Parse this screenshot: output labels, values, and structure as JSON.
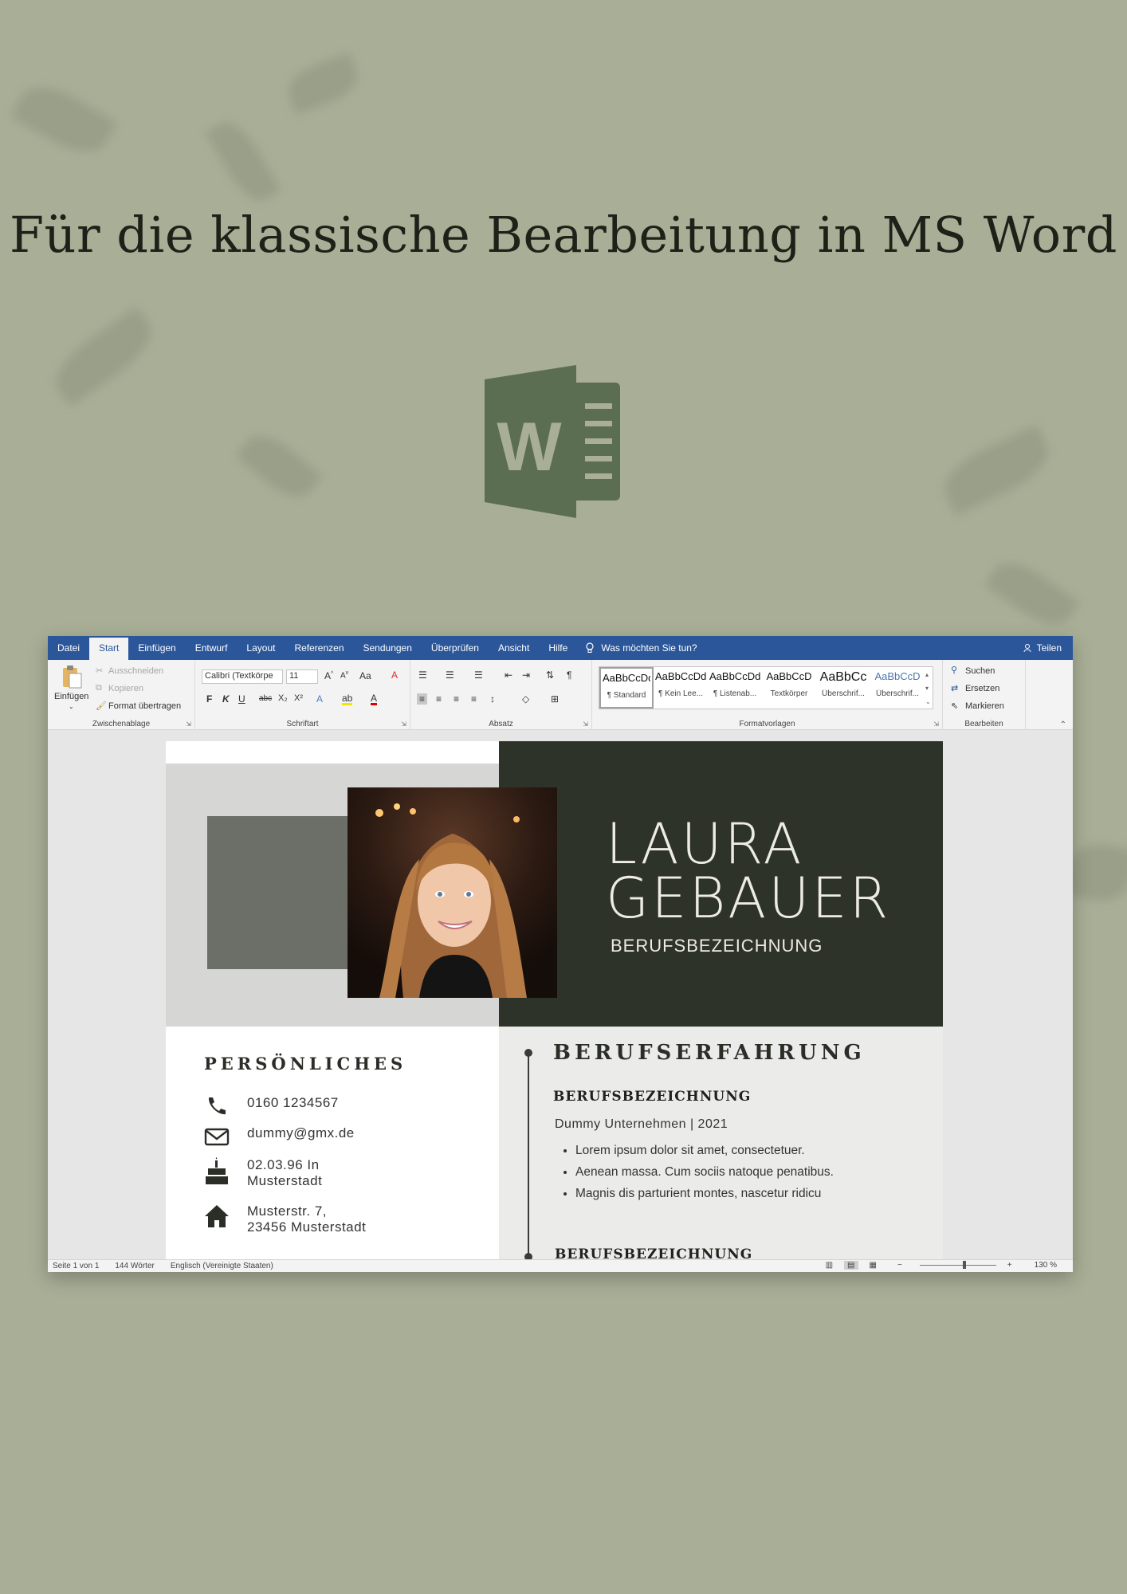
{
  "headline": "Für die klassische Bearbeitung in MS Word",
  "logo": {
    "icon": "ms-word-icon",
    "color": "#5c6e52",
    "letter": "W"
  },
  "menu": {
    "tabs": [
      "Datei",
      "Start",
      "Einfügen",
      "Entwurf",
      "Layout",
      "Referenzen",
      "Sendungen",
      "Überprüfen",
      "Ansicht",
      "Hilfe"
    ],
    "active_tab": "Start",
    "tell_me": "Was möchten Sie tun?",
    "share": "Teilen"
  },
  "ribbon": {
    "clipboard": {
      "paste": "Einfügen",
      "cut": "Ausschneiden",
      "copy": "Kopieren",
      "format_painter": "Format übertragen",
      "label": "Zwischenablage"
    },
    "font": {
      "name": "Calibri (Textkörpe",
      "size": "11",
      "bold": "F",
      "italic": "K",
      "underline": "U",
      "strike": "abc",
      "sub": "X₂",
      "sup": "X²",
      "case": "Aa",
      "label": "Schriftart"
    },
    "paragraph": {
      "label": "Absatz"
    },
    "styles": {
      "items": [
        {
          "preview": "AaBbCcDd",
          "name": "¶ Standard"
        },
        {
          "preview": "AaBbCcDd",
          "name": "¶ Kein Lee..."
        },
        {
          "preview": "AaBbCcDd",
          "name": "¶ Listenab..."
        },
        {
          "preview": "AaBbCcD",
          "name": "Textkörper"
        },
        {
          "preview": "AaBbCc",
          "name": "Überschrif..."
        },
        {
          "preview": "AaBbCcD",
          "name": "Überschrif..."
        }
      ],
      "label": "Formatvorlagen"
    },
    "editing": {
      "find": "Suchen",
      "replace": "Ersetzen",
      "select": "Markieren",
      "label": "Bearbeiten"
    }
  },
  "resume": {
    "first_name": "LAURA",
    "last_name": "GEBAUER",
    "job_title": "BERUFSBEZEICHNUNG",
    "personal_title": "PERSÖNLICHES",
    "contacts": [
      {
        "icon": "phone-icon",
        "line1": "0160 1234567",
        "line2": ""
      },
      {
        "icon": "mail-icon",
        "line1": "dummy@gmx.de",
        "line2": ""
      },
      {
        "icon": "cake-icon",
        "line1": "02.03.96 In",
        "line2": "Musterstadt"
      },
      {
        "icon": "home-icon",
        "line1": "Musterstr. 7,",
        "line2": "23456 Musterstadt"
      }
    ],
    "experience_title": "BERUFSERFAHRUNG",
    "position_title": "BERUFSBEZEICHNUNG",
    "company": "Dummy Unternehmen | 2021",
    "bullets": [
      "Lorem ipsum dolor sit amet, consectetuer.",
      "Aenean massa. Cum sociis natoque penatibus.",
      "Magnis dis parturient montes, nascetur ridicu"
    ],
    "position_title_2": "BERUFSBEZEICHNUNG"
  },
  "status": {
    "page": "Seite 1 von 1",
    "words": "144 Wörter",
    "language": "Englisch (Vereinigte Staaten)",
    "zoom": "130 %"
  }
}
